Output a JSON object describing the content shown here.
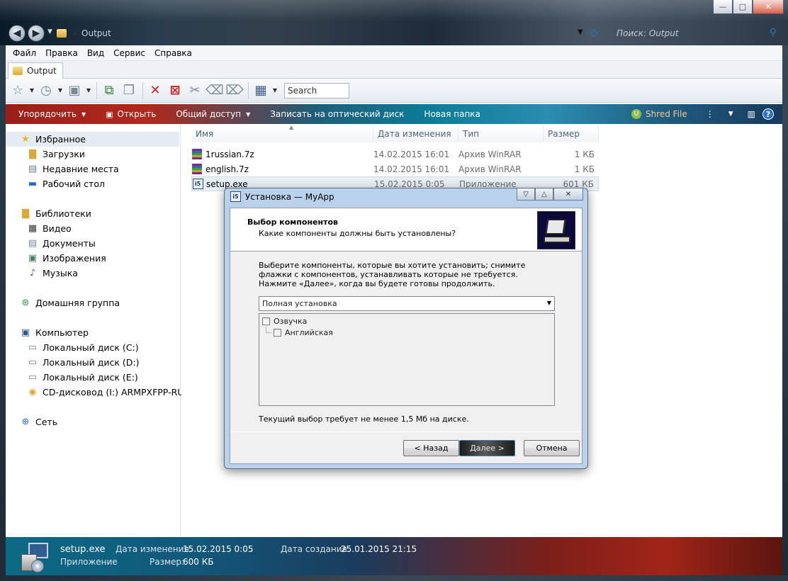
{
  "window": {
    "breadcrumb": [
      "Output"
    ],
    "search_placeholder": "Поиск: Output",
    "controls": {
      "minimize": "—",
      "maximize": "□",
      "close": "✕"
    }
  },
  "menu": [
    "Файл",
    "Правка",
    "Вид",
    "Сервис",
    "Справка"
  ],
  "tab": {
    "label": "Output"
  },
  "toolbar": {
    "search_value": "Search"
  },
  "commandbar": {
    "organize": "Упорядочить",
    "open": "Открыть",
    "share": "Общий доступ",
    "burn": "Записать на оптический диск",
    "new_folder": "Новая папка",
    "shred": "Shred File"
  },
  "nav": {
    "favorites": "Избранное",
    "downloads": "Загрузки",
    "recent": "Недавние места",
    "desktop": "Рабочий стол",
    "libraries": "Библиотеки",
    "video": "Видео",
    "documents": "Документы",
    "images": "Изображения",
    "music": "Музыка",
    "homegroup": "Домашняя группа",
    "computer": "Компьютер",
    "disk_c": "Локальный диск (C:)",
    "disk_d": "Локальный диск (D:)",
    "disk_e": "Локальный диск (E:)",
    "cd": "CD-дисковод (I:) ARMPXFPP-RU-",
    "network": "Сеть"
  },
  "columns": {
    "name": "Имя",
    "date": "Дата изменения",
    "type": "Тип",
    "size": "Размер"
  },
  "files": [
    {
      "name": "1russian.7z",
      "date": "14.02.2015 16:01",
      "type": "Архив WinRAR",
      "size": "1 КБ",
      "icon": "rar-archive-icon"
    },
    {
      "name": "english.7z",
      "date": "14.02.2015 16:01",
      "type": "Архив WinRAR",
      "size": "1 КБ",
      "icon": "rar-archive-icon"
    },
    {
      "name": "setup.exe",
      "date": "15.02.2015 0:05",
      "type": "Приложение",
      "size": "601 КБ",
      "icon": "setup-exe-icon"
    }
  ],
  "details": {
    "name": "setup.exe",
    "type": "Приложение",
    "modified_label": "Дата изменения:",
    "modified_value": "15.02.2015 0:05",
    "created_label": "Дата создания:",
    "created_value": "25.01.2015 21:15",
    "size_label": "Размер:",
    "size_value": "600 КБ"
  },
  "dialog": {
    "title": "Установка — MyApp",
    "heading": "Выбор компонентов",
    "subheading": "Какие компоненты должны быть установлены?",
    "description": "Выберите компоненты, которые вы хотите установить; снимите флажки с компонентов, устанавливать которые не требуется. Нажмите «Далее», когда вы будете готовы продолжить.",
    "setup_type": "Полная установка",
    "components": [
      {
        "label": "Озвучка",
        "checked": false
      },
      {
        "label": "Английская",
        "checked": false
      }
    ],
    "disk_requirement": "Текущий выбор требует не менее 1,5 Мб на диске.",
    "back": "< Назад",
    "next": "Далее >",
    "cancel": "Отмена"
  }
}
